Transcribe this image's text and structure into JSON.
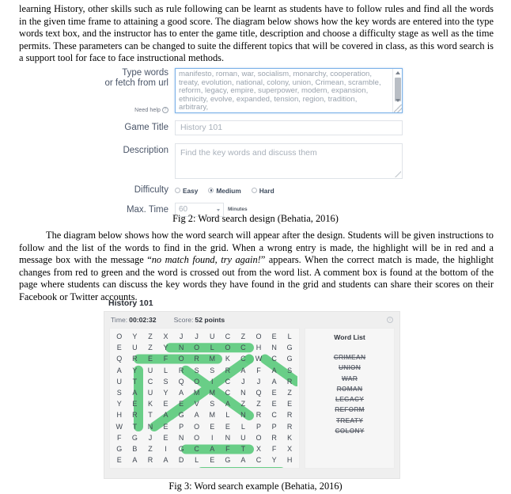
{
  "paragraphs": {
    "intro": "learning History, other skills such as rule following can be learnt as students have to follow rules and find all the words in the given time frame to attaining a good score. The diagram below shows how the key words are entered into the type words text box, and the instructor has to enter the game title, description and choose a difficulty stage as well as the time permits. These parameters can be changed to suite the different topics that will be covered in class, as this word search is a support tool for face to face instructional methods.",
    "second_a": "The diagram below shows how the word search will appear after the design. Students will be given instructions to follow and the list of the words to find in the grid. When a wrong entry is made, the highlight will be in red and a message box with the message “",
    "second_quote": "no match found, try again!",
    "second_b": "” appears. When the correct match is made, the highlight changes from red to green and the word is crossed out from the word list. A comment box is found at the bottom of the page where students can discuss the key words they have found in the grid and students can share their scores on their Facebook or Twitter accounts."
  },
  "captions": {
    "fig2": "Fig 2: Word search design (Behatia, 2016)",
    "fig3": "Fig 3: Word search example (Behatia, 2016)"
  },
  "form": {
    "type_words_label_line1": "Type words",
    "type_words_label_line2": "or fetch from url",
    "need_help_label": "Need help",
    "need_help_icon": "question-mark-icon",
    "words_value": "manifesto, roman, war, socialism, monarchy, cooperation, treaty, evolution, national, colony, union, Crimean, scramble, reform, legacy, empire, superpower, modern, expansion, ethnicity, evolve, expanded, tension, region, tradition, arbitrary,",
    "game_title_label": "Game Title",
    "game_title_value": "History 101",
    "description_label": "Description",
    "description_value": "Find the key words and discuss them",
    "difficulty_label": "Difficulty",
    "difficulty_options": [
      "Easy",
      "Medium",
      "Hard"
    ],
    "difficulty_selected": "Medium",
    "max_time_label": "Max. Time",
    "max_time_value": "60",
    "minutes_label": "Minutes"
  },
  "wordsearch": {
    "title": "History 101",
    "time_label": "Time:",
    "time_value": "00:02:32",
    "score_label": "Score:",
    "score_value": "52 points",
    "info_icon": "info-icon",
    "word_list_title": "Word List",
    "words": [
      "CRIMEAN",
      "UNION",
      "WAR",
      "ROMAN",
      "LEGACY",
      "REFORM",
      "TREATY",
      "COLONY"
    ],
    "grid": [
      [
        "O",
        "Y",
        "Z",
        "X",
        "J",
        "J",
        "U",
        "C",
        "Z",
        "O",
        "E",
        "L"
      ],
      [
        "E",
        "U",
        "Z",
        "Y",
        "N",
        "O",
        "L",
        "O",
        "C",
        "H",
        "N",
        "G"
      ],
      [
        "Q",
        "R",
        "E",
        "F",
        "O",
        "R",
        "M",
        "K",
        "C",
        "W",
        "C",
        "G"
      ],
      [
        "A",
        "Y",
        "U",
        "L",
        "R",
        "S",
        "S",
        "R",
        "A",
        "F",
        "A",
        "S"
      ],
      [
        "U",
        "T",
        "C",
        "S",
        "Q",
        "O",
        "I",
        "C",
        "J",
        "J",
        "A",
        "R"
      ],
      [
        "S",
        "A",
        "U",
        "Y",
        "A",
        "M",
        "M",
        "C",
        "N",
        "Q",
        "E",
        "Z"
      ],
      [
        "Y",
        "E",
        "K",
        "E",
        "E",
        "V",
        "S",
        "A",
        "Z",
        "Z",
        "E",
        "E"
      ],
      [
        "H",
        "R",
        "T",
        "A",
        "G",
        "A",
        "M",
        "L",
        "N",
        "R",
        "C",
        "R"
      ],
      [
        "W",
        "T",
        "N",
        "E",
        "P",
        "O",
        "E",
        "E",
        "L",
        "P",
        "P",
        "R"
      ],
      [
        "F",
        "G",
        "J",
        "E",
        "N",
        "O",
        "I",
        "N",
        "U",
        "O",
        "R",
        "K"
      ],
      [
        "G",
        "B",
        "Z",
        "I",
        "G",
        "C",
        "A",
        "F",
        "T",
        "X",
        "F",
        "X"
      ],
      [
        "E",
        "A",
        "R",
        "A",
        "D",
        "L",
        "E",
        "G",
        "A",
        "C",
        "Y",
        "H"
      ]
    ],
    "highlight_color": "#5ecb7e",
    "highlights": [
      {
        "word": "COLONY",
        "from": [
          1,
          3
        ],
        "to": [
          1,
          8
        ]
      },
      {
        "word": "REFORM",
        "from": [
          2,
          1
        ],
        "to": [
          2,
          6
        ]
      },
      {
        "word": "TREATY",
        "from": [
          3,
          1
        ],
        "to": [
          8,
          1
        ]
      },
      {
        "word": "UNION",
        "from": [
          9,
          4
        ],
        "to": [
          9,
          8
        ]
      },
      {
        "word": "LEGACY",
        "from": [
          11,
          5
        ],
        "to": [
          11,
          10
        ]
      },
      {
        "word": "CRIMEAN",
        "from": [
          2,
          8
        ],
        "to": [
          8,
          8
        ]
      },
      {
        "word": "WAR",
        "from": [
          2,
          9
        ],
        "to": [
          4,
          11
        ]
      },
      {
        "word": "ROMAN",
        "from": [
          3,
          4
        ],
        "to": [
          8,
          2
        ]
      },
      {
        "word": "ROMAN2",
        "from": [
          3,
          7
        ],
        "to": [
          6,
          4
        ]
      }
    ]
  }
}
